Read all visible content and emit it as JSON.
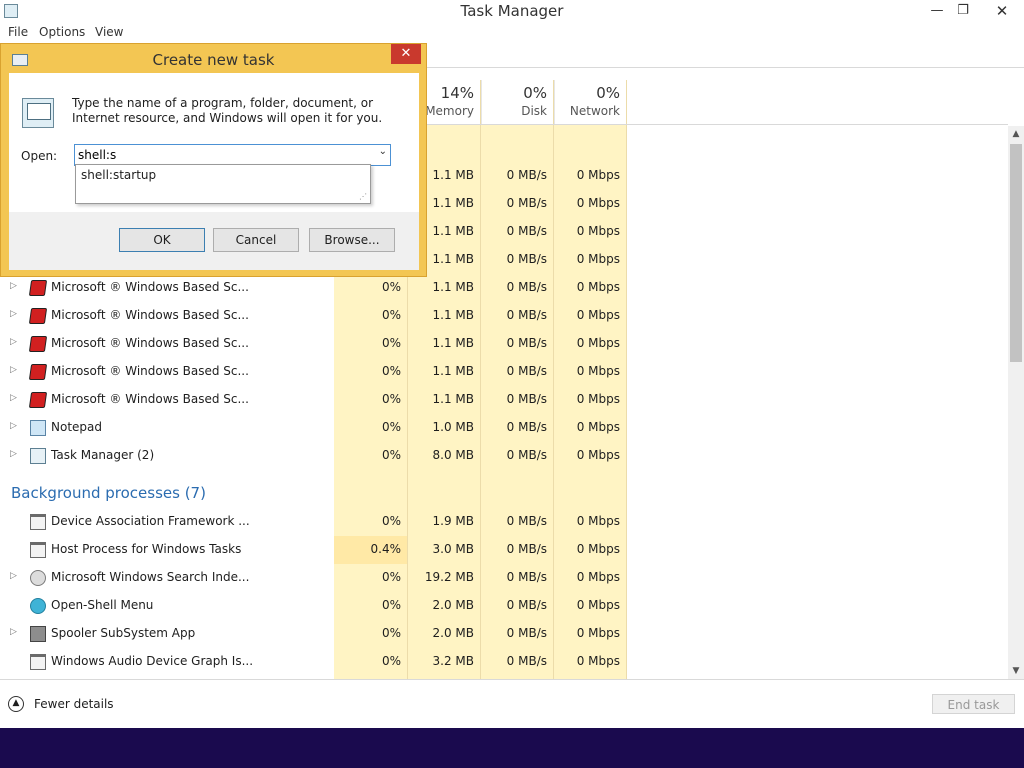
{
  "window": {
    "title": "Task Manager",
    "min_glyph": "—",
    "max_glyph": "❐",
    "close_glyph": "✕"
  },
  "menu": [
    "File",
    "Options",
    "View"
  ],
  "columns": {
    "memory": {
      "percent": "14%",
      "label": "Memory"
    },
    "disk": {
      "percent": "0%",
      "label": "Disk"
    },
    "network": {
      "percent": "0%",
      "label": "Network"
    }
  },
  "apps_rows_partial": [
    {
      "mem": "1.1 MB",
      "disk": "0 MB/s",
      "net": "0 Mbps"
    },
    {
      "mem": "1.1 MB",
      "disk": "0 MB/s",
      "net": "0 Mbps"
    },
    {
      "mem": "1.1 MB",
      "disk": "0 MB/s",
      "net": "0 Mbps"
    },
    {
      "mem": "1.1 MB",
      "disk": "0 MB/s",
      "net": "0 Mbps"
    }
  ],
  "apps_rows": [
    {
      "name": "Microsoft ® Windows Based Sc...",
      "icon": "ms-app-icon",
      "cpu": "0%",
      "mem": "1.1 MB",
      "disk": "0 MB/s",
      "net": "0 Mbps"
    },
    {
      "name": "Microsoft ® Windows Based Sc...",
      "icon": "ms-app-icon",
      "cpu": "0%",
      "mem": "1.1 MB",
      "disk": "0 MB/s",
      "net": "0 Mbps"
    },
    {
      "name": "Microsoft ® Windows Based Sc...",
      "icon": "ms-app-icon",
      "cpu": "0%",
      "mem": "1.1 MB",
      "disk": "0 MB/s",
      "net": "0 Mbps"
    },
    {
      "name": "Microsoft ® Windows Based Sc...",
      "icon": "ms-app-icon",
      "cpu": "0%",
      "mem": "1.1 MB",
      "disk": "0 MB/s",
      "net": "0 Mbps"
    },
    {
      "name": "Microsoft ® Windows Based Sc...",
      "icon": "ms-app-icon",
      "cpu": "0%",
      "mem": "1.1 MB",
      "disk": "0 MB/s",
      "net": "0 Mbps"
    },
    {
      "name": "Notepad",
      "icon": "notepad-icon",
      "cpu": "0%",
      "mem": "1.0 MB",
      "disk": "0 MB/s",
      "net": "0 Mbps"
    },
    {
      "name": "Task Manager (2)",
      "icon": "task-manager-icon",
      "cpu": "0%",
      "mem": "8.0 MB",
      "disk": "0 MB/s",
      "net": "0 Mbps"
    }
  ],
  "background_section": "Background processes (7)",
  "background_rows": [
    {
      "name": "Device Association Framework ...",
      "icon": "window-icon",
      "cpu": "0%",
      "mem": "1.9 MB",
      "disk": "0 MB/s",
      "net": "0 Mbps"
    },
    {
      "name": "Host Process for Windows Tasks",
      "icon": "window-icon",
      "cpu": "0.4%",
      "mem": "3.0 MB",
      "disk": "0 MB/s",
      "net": "0 Mbps"
    },
    {
      "name": "Microsoft Windows Search Inde...",
      "icon": "search-indexer-icon",
      "cpu": "0%",
      "mem": "19.2 MB",
      "disk": "0 MB/s",
      "net": "0 Mbps"
    },
    {
      "name": "Open-Shell Menu",
      "icon": "globe-icon",
      "cpu": "0%",
      "mem": "2.0 MB",
      "disk": "0 MB/s",
      "net": "0 Mbps"
    },
    {
      "name": "Spooler SubSystem App",
      "icon": "printer-icon",
      "cpu": "0%",
      "mem": "2.0 MB",
      "disk": "0 MB/s",
      "net": "0 Mbps"
    },
    {
      "name": "Windows Audio Device Graph Is...",
      "icon": "window-icon",
      "cpu": "0%",
      "mem": "3.2 MB",
      "disk": "0 MB/s",
      "net": "0 Mbps"
    }
  ],
  "footer": {
    "fewer_details": "Fewer details",
    "end_task": "End task"
  },
  "dialog": {
    "title": "Create new task",
    "close_glyph": "✕",
    "description": "Type the name of a program, folder, document, or Internet resource, and Windows will open it for you.",
    "open_label": "Open:",
    "open_value": "shell:s",
    "suggestion": "shell:startup",
    "ok": "OK",
    "cancel": "Cancel",
    "browse": "Browse..."
  },
  "colors": {
    "heat": "#fff4c4",
    "dialog_frame": "#f3c653",
    "close_red": "#c9392d",
    "section_blue": "#2b6cb0",
    "taskbar": "#1a0a4e"
  }
}
